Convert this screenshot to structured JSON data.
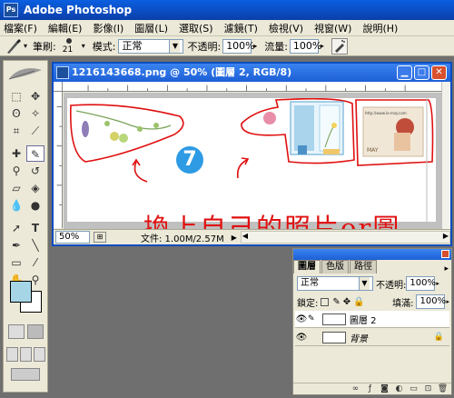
{
  "app": {
    "title": "Adobe Photoshop"
  },
  "menu": [
    "檔案(F)",
    "編輯(E)",
    "影像(I)",
    "圖層(L)",
    "選取(S)",
    "濾鏡(T)",
    "檢視(V)",
    "視窗(W)",
    "說明(H)"
  ],
  "options": {
    "brush_label": "筆刷:",
    "brush_size": "21",
    "mode_label": "模式:",
    "mode_value": "正常",
    "opacity_label": "不透明:",
    "opacity_value": "100%",
    "flow_label": "流量:",
    "flow_value": "100%"
  },
  "document": {
    "title": "1216143668.png @ 50% (圖層 2, RGB/8)",
    "zoom": "50%",
    "file_info": "文件: 1.00M/2.57M",
    "overlay_text": "換上自己的照片or圖",
    "badge_number": "7",
    "card_url": "http://www.lo-mzy.com",
    "card_text": "MAY"
  },
  "layers": {
    "tabs": [
      "圖層",
      "色版",
      "路徑"
    ],
    "mode": "正常",
    "opacity_label": "不透明:",
    "opacity_value": "100%",
    "lock_label": "鎖定:",
    "fill_label": "填滿:",
    "fill_value": "100%",
    "items": [
      {
        "name": "圖層 2"
      },
      {
        "name": "背景"
      }
    ]
  },
  "colors": {
    "accent_red": "#e01010",
    "foreground_swatch": "#a6d6e6",
    "badge_blue": "#2e9be4"
  }
}
